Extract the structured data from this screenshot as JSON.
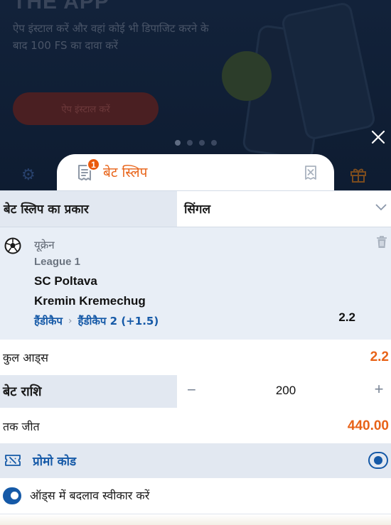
{
  "banner": {
    "title": "THE APP",
    "text": "ऐप इंस्टाल करें और वहां कोई भी डिपाजिट करने के बाद 100 FS का दावा करें",
    "cta_label": "ऐप इंस्टाल करें",
    "dots": [
      true,
      false,
      false,
      false
    ]
  },
  "bet_slip": {
    "tab_title": "बेट स्लिप",
    "count": "1",
    "type_label": "बेट स्लिप का प्रकार",
    "type_value": "सिंगल",
    "event": {
      "sport": "यूक्रेन",
      "league": "League 1",
      "team1": "SC Poltava",
      "team2": "Kremin Kremechug",
      "market_group": "हैंडीकैप",
      "market": "हैंडीकैप 2 (+1.5)",
      "odd": "2.2"
    },
    "total_odds_label": "कुल आड्स",
    "total_odds_value": "2.2",
    "stake_label": "बेट राशि",
    "stake_value": "200",
    "stake_minus": "−",
    "stake_plus": "+",
    "winnings_label": "तक जीत",
    "winnings_value": "440.00",
    "promo_label": "प्रोमो कोड",
    "accept_label": "ऑड्स में बदलाव स्वीकार करें"
  },
  "colors": {
    "accent_orange": "#e86318",
    "accent_blue": "#1559a7",
    "badge": "#ea5a0c"
  }
}
